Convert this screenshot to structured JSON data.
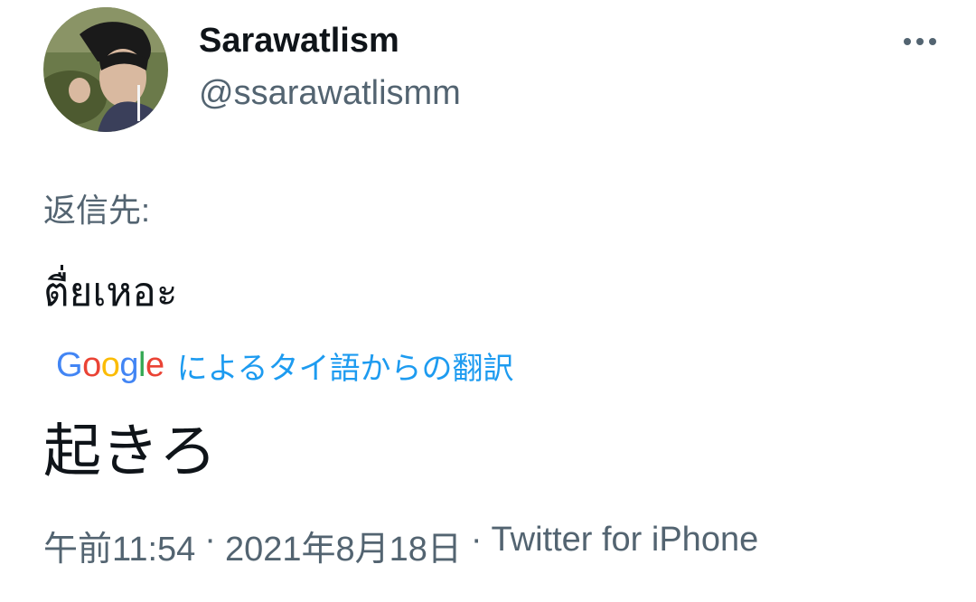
{
  "author": {
    "display_name": "Sarawatlism",
    "handle": "@ssarawatlismm",
    "avatar_icon": "profile-photo"
  },
  "menu": {
    "more_icon": "more-horizontal-icon"
  },
  "reply_to_label": "返信先:",
  "tweet": {
    "text": "ตื่ยเหอะ",
    "translation": {
      "provider_letters": [
        "G",
        "o",
        "o",
        "g",
        "l",
        "e"
      ],
      "label": "によるタイ語からの翻訳",
      "text": "起きろ"
    },
    "time": "午前11:54",
    "date": "2021年8月18日",
    "source": "Twitter for iPhone",
    "separator": "·"
  },
  "colors": {
    "primary_text": "#0f1419",
    "secondary_text": "#536471",
    "link_blue": "#1d9bf0"
  }
}
